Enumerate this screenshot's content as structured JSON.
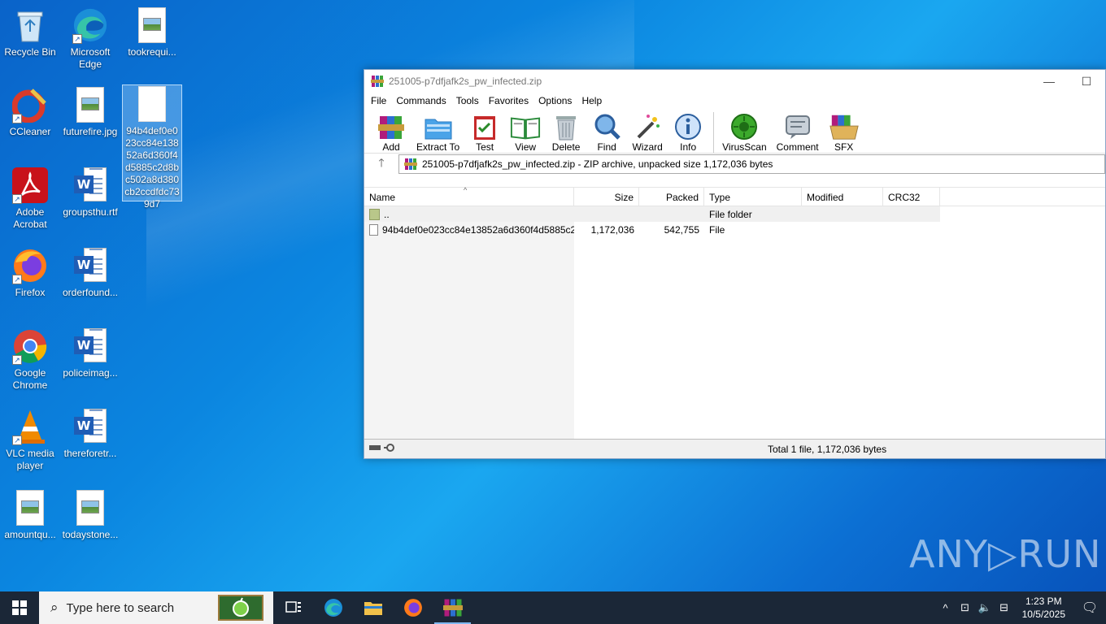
{
  "desktop": {
    "icons": [
      {
        "label": "Recycle Bin"
      },
      {
        "label": "Microsoft Edge"
      },
      {
        "label": "tookrequi..."
      },
      {
        "label": "CCleaner"
      },
      {
        "label": "futurefire.jpg"
      },
      {
        "label": "94b4def0e023cc84e13852a6d360f4d5885c2d8bc502a8d380cb2ccdfdc739d7"
      },
      {
        "label": "Adobe Acrobat"
      },
      {
        "label": "groupsthu.rtf"
      },
      {
        "label": "Firefox"
      },
      {
        "label": "orderfound..."
      },
      {
        "label": "Google Chrome"
      },
      {
        "label": "policeimag..."
      },
      {
        "label": "VLC media player"
      },
      {
        "label": "thereforetr..."
      },
      {
        "label": "amountqu..."
      },
      {
        "label": "todaystone..."
      }
    ]
  },
  "window": {
    "title": "251005-p7dfjafk2s_pw_infected.zip",
    "minimize": "—",
    "maximize": "☐",
    "menu": [
      "File",
      "Commands",
      "Tools",
      "Favorites",
      "Options",
      "Help"
    ],
    "toolbar": [
      "Add",
      "Extract To",
      "Test",
      "View",
      "Delete",
      "Find",
      "Wizard",
      "Info",
      "VirusScan",
      "Comment",
      "SFX"
    ],
    "address": "251005-p7dfjafk2s_pw_infected.zip - ZIP archive, unpacked size 1,172,036 bytes",
    "columns": [
      "Name",
      "Size",
      "Packed",
      "Type",
      "Modified",
      "CRC32"
    ],
    "rows": [
      {
        "name": "..",
        "size": "",
        "packed": "",
        "type": "File folder",
        "modified": "",
        "crc": ""
      },
      {
        "name": "94b4def0e023cc84e13852a6d360f4d5885c2...",
        "size": "1,172,036",
        "packed": "542,755",
        "type": "File",
        "modified": "",
        "crc": ""
      }
    ],
    "status": "Total 1 file, 1,172,036 bytes"
  },
  "taskbar": {
    "search_placeholder": "Type here to search",
    "time": "1:23 PM",
    "date": "10/5/2025"
  },
  "watermark": "ANY▷RUN"
}
